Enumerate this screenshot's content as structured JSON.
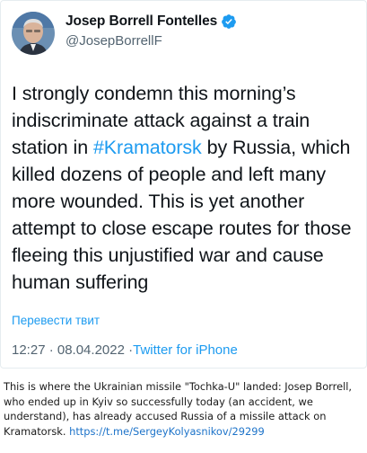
{
  "tweet": {
    "display_name": "Josep Borrell Fontelles",
    "handle": "@JosepBorrellF",
    "text_before": "I strongly condemn this morning’s indiscriminate attack against a train station in ",
    "hashtag": "#Kramatorsk",
    "text_after": " by Russia, which  killed dozens of people and left many more wounded. This is yet another attempt to close escape routes for those fleeing this unjustified war and cause human suffering",
    "translate_label": "Перевести твит",
    "time": "12:27 · 08.04.2022 · ",
    "source": "Twitter for iPhone",
    "verified_icon": "verified-badge",
    "accent_color": "#1d9bf0"
  },
  "caption": {
    "text": "This is where the Ukrainian missile \"Tochka-U\" landed: Josep Borrell, who ended up in Kyiv so successfully today (an accident, we understand), has already accused Russia of a missile attack on Kramatorsk. ",
    "link": "https://t.me/SergeyKolyasnikov/29299"
  }
}
